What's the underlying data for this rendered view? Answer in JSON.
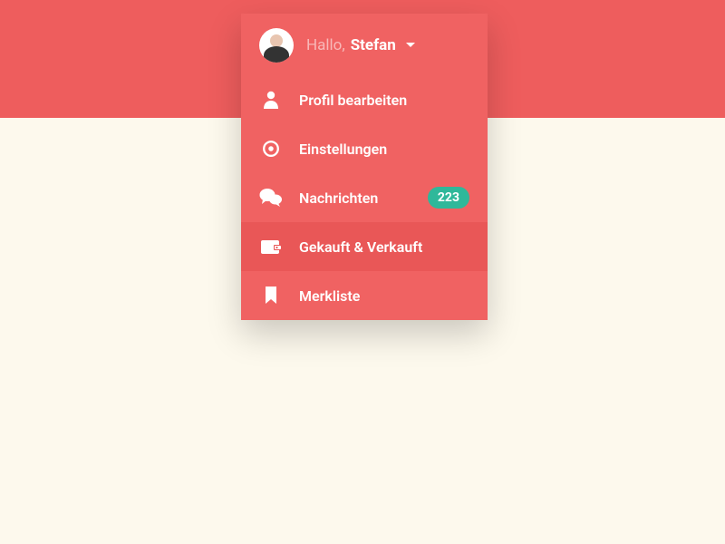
{
  "colors": {
    "menu_bg": "#f06262",
    "menu_selected": "#e95757",
    "banner": "#ee5d5d",
    "page_bg": "#fdf9ed",
    "badge_bg": "#2fb89a"
  },
  "header": {
    "greeting_prefix": "Hallo,",
    "user_name": "Stefan"
  },
  "menu": {
    "items": [
      {
        "icon": "user-icon",
        "label": "Profil bearbeiten",
        "badge": null,
        "selected": false
      },
      {
        "icon": "gear-icon",
        "label": "Einstellungen",
        "badge": null,
        "selected": false
      },
      {
        "icon": "chat-icon",
        "label": "Nachrichten",
        "badge": "223",
        "selected": false
      },
      {
        "icon": "wallet-icon",
        "label": "Gekauft & Verkauft",
        "badge": null,
        "selected": true
      },
      {
        "icon": "bookmark-icon",
        "label": "Merkliste",
        "badge": null,
        "selected": false
      }
    ]
  }
}
